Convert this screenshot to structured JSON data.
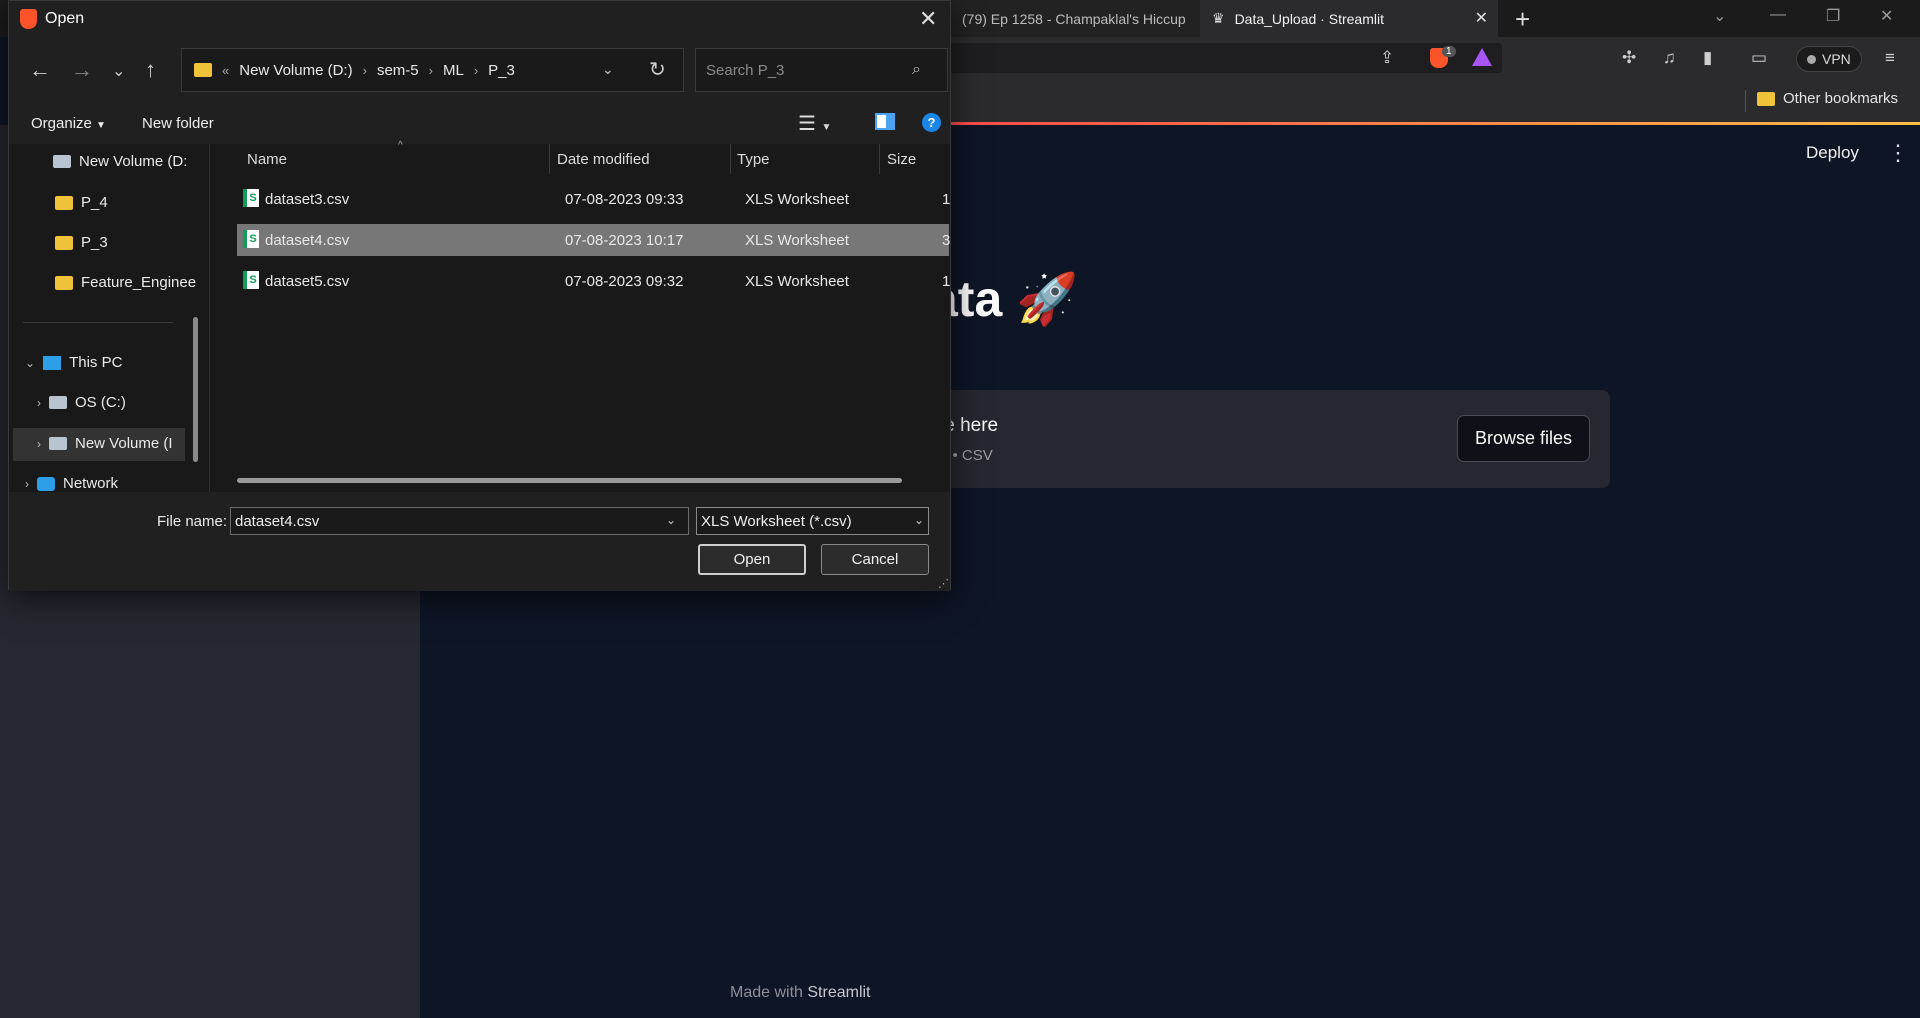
{
  "browser": {
    "tabs": [
      {
        "title": "(79) Ep 1258 - Champaklal's Hiccup",
        "active": false
      },
      {
        "title": "Data_Upload · Streamlit",
        "active": true
      }
    ],
    "new_tab": "+",
    "vpn_label": "VPN",
    "shields_badge": "1",
    "bookmarks": {
      "other_label": "Other bookmarks"
    }
  },
  "app": {
    "deploy_label": "Deploy",
    "title_fragment": "ata 🚀",
    "uploader": {
      "drop_text_fragment": "le here",
      "sub_text_fragment": "e • CSV",
      "browse_label": "Browse files"
    },
    "footer": {
      "prefix": "Made with",
      "brand": "Streamlit"
    }
  },
  "dialog": {
    "title": "Open",
    "breadcrumb": [
      "New Volume (D:)",
      "sem-5",
      "ML",
      "P_3"
    ],
    "breadcrumb_prefix": "«",
    "search_placeholder": "Search P_3",
    "organize_label": "Organize",
    "new_folder_label": "New folder",
    "help_glyph": "?",
    "nav_items": [
      {
        "label": "New Volume (D:",
        "icon": "drive-icon"
      },
      {
        "label": "P_4",
        "icon": "folder-icon"
      },
      {
        "label": "P_3",
        "icon": "folder-icon"
      },
      {
        "label": "Feature_Enginee",
        "icon": "folder-icon"
      },
      {
        "label": "This PC",
        "icon": "pc-icon"
      },
      {
        "label": "OS (C:)",
        "icon": "drive-icon"
      },
      {
        "label": "New Volume (I",
        "icon": "drive-icon",
        "selected": true
      },
      {
        "label": "Network",
        "icon": "network-icon"
      }
    ],
    "columns": [
      "Name",
      "Date modified",
      "Type",
      "Size"
    ],
    "files": [
      {
        "name": "dataset3.csv",
        "date": "07-08-2023 09:33",
        "type": "XLS Worksheet",
        "size": "1"
      },
      {
        "name": "dataset4.csv",
        "date": "07-08-2023 10:17",
        "type": "XLS Worksheet",
        "size": "3",
        "selected": true
      },
      {
        "name": "dataset5.csv",
        "date": "07-08-2023 09:32",
        "type": "XLS Worksheet",
        "size": "1"
      }
    ],
    "file_name_label": "File name:",
    "file_name_value": "dataset4.csv",
    "file_type_value": "XLS Worksheet (*.csv)",
    "open_label": "Open",
    "cancel_label": "Cancel"
  }
}
